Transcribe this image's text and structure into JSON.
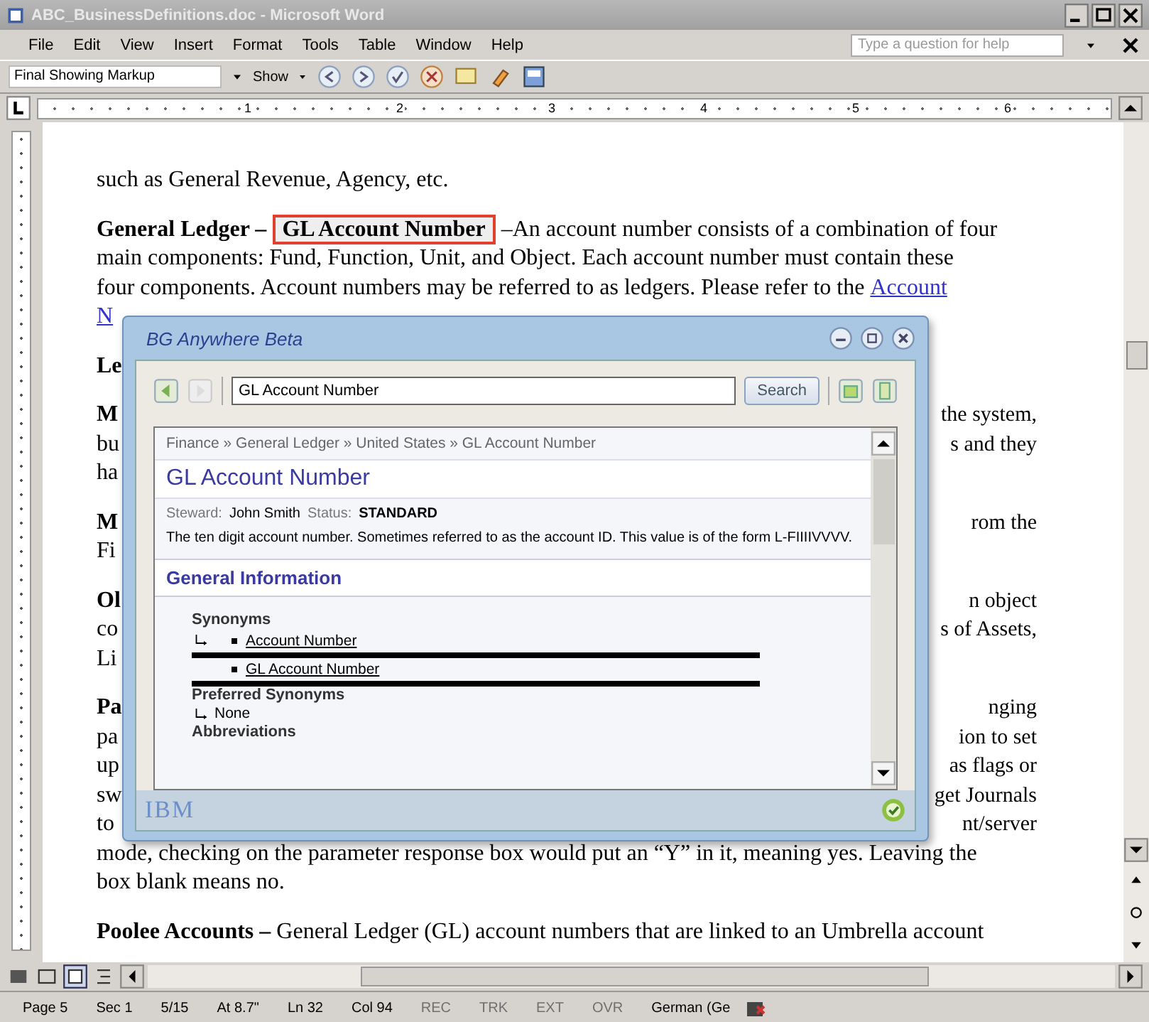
{
  "window": {
    "title": "ABC_BusinessDefinitions.doc - Microsoft Word"
  },
  "menu": [
    "File",
    "Edit",
    "View",
    "Insert",
    "Format",
    "Tools",
    "Table",
    "Window",
    "Help"
  ],
  "help_box": {
    "placeholder": "Type a question for help"
  },
  "toolbar": {
    "markup_dropdown": "Final Showing Markup",
    "show_button": "Show"
  },
  "ruler": {
    "marks": [
      "1",
      "2",
      "3",
      "4",
      "5",
      "6"
    ]
  },
  "document": {
    "paragraphs": [
      {
        "lines": [
          {
            "runs": [
              {
                "kind": "text",
                "text": "such as General Revenue, Agency, etc."
              }
            ]
          }
        ]
      },
      {
        "lines": [
          {
            "runs": [
              {
                "kind": "text",
                "text": "**General Ledger –**"
              },
              {
                "kind": "term",
                "text": "GL Account Number"
              },
              {
                "kind": "text",
                "text": "–An account number consists of a combination of four"
              }
            ]
          },
          {
            "runs": [
              {
                "kind": "text",
                "text": "main components: Fund, Function, Unit, and Object. Each account number must contain these"
              }
            ]
          },
          {
            "runs": [
              {
                "kind": "text",
                "text": "four components. Account numbers may be referred to as ledgers. Please refer to the"
              },
              {
                "kind": "link",
                "text": "Account"
              }
            ]
          },
          {
            "runs": [
              {
                "kind": "link",
                "text": "N"
              }
            ]
          }
        ]
      },
      {
        "lines": [
          {
            "runs": [
              {
                "kind": "text",
                "text": "**Le**"
              }
            ]
          }
        ]
      },
      {
        "lines": [
          {
            "runs": [
              {
                "kind": "text",
                "text": "**M**"
              }
            ],
            "right": "the system,"
          },
          {
            "runs": [
              {
                "kind": "text",
                "text": "bu"
              }
            ],
            "right": "s and they"
          },
          {
            "runs": [
              {
                "kind": "text",
                "text": "ha"
              }
            ]
          }
        ]
      },
      {
        "lines": [
          {
            "runs": [
              {
                "kind": "text",
                "text": "**M**"
              }
            ],
            "right": "rom the"
          },
          {
            "runs": [
              {
                "kind": "text",
                "text": "Fi"
              }
            ]
          }
        ]
      },
      {
        "lines": [
          {
            "runs": [
              {
                "kind": "text",
                "text": "**Ol**"
              }
            ],
            "right": "n object"
          },
          {
            "runs": [
              {
                "kind": "text",
                "text": "co"
              }
            ],
            "right": "s of Assets,"
          },
          {
            "runs": [
              {
                "kind": "text",
                "text": "Li"
              }
            ]
          }
        ]
      },
      {
        "lines": [
          {
            "runs": [
              {
                "kind": "text",
                "text": "**Pa**"
              }
            ],
            "right": "nging"
          },
          {
            "runs": [
              {
                "kind": "text",
                "text": "pa"
              }
            ],
            "right": "ion to set"
          },
          {
            "runs": [
              {
                "kind": "text",
                "text": "up"
              }
            ],
            "right": "as flags or"
          },
          {
            "runs": [
              {
                "kind": "text",
                "text": "sw"
              }
            ],
            "right": "get Journals"
          },
          {
            "runs": [
              {
                "kind": "text",
                "text": "to"
              }
            ],
            "right": "nt/server"
          },
          {
            "runs": [
              {
                "kind": "text",
                "text": "mode, checking on the parameter response box would put an “Y” in it, meaning yes. Leaving the"
              }
            ]
          },
          {
            "runs": [
              {
                "kind": "text",
                "text": "box blank means no."
              }
            ]
          }
        ]
      },
      {
        "lines": [
          {
            "runs": [
              {
                "kind": "text",
                "text": "**Poolee Accounts –** General Ledger (GL) account numbers that are linked to an Umbrella account"
              }
            ]
          }
        ]
      }
    ]
  },
  "popup": {
    "title": "BG Anywhere Beta",
    "search": {
      "value": "GL Account Number",
      "button": "Search"
    },
    "breadcrumb": "Finance » General Ledger » United States » GL Account Number",
    "heading": "GL Account Number",
    "steward_label": "Steward:",
    "steward": "John Smith",
    "status_label": "Status:",
    "status": "STANDARD",
    "description": "The ten digit account number. Sometimes referred to as the account ID. This value is of the form L-FIIIIVVVV.",
    "section": "General Information",
    "groups": [
      {
        "kind": "list",
        "label": "Synonyms",
        "items": [
          "Account Number",
          "GL Account Number"
        ]
      },
      {
        "kind": "value",
        "label": "Preferred Synonyms",
        "value": "None"
      },
      {
        "kind": "empty",
        "label": "Abbreviations"
      }
    ],
    "footer_logo": "IBM"
  },
  "status_bar": [
    {
      "text": "Page 5",
      "disabled": false
    },
    {
      "text": "Sec 1",
      "disabled": false
    },
    {
      "text": "5/15",
      "disabled": false
    },
    {
      "text": "At 8.7\"",
      "disabled": false
    },
    {
      "text": "Ln 32",
      "disabled": false
    },
    {
      "text": "Col 94",
      "disabled": false
    },
    {
      "text": "REC",
      "disabled": true
    },
    {
      "text": "TRK",
      "disabled": true
    },
    {
      "text": "EXT",
      "disabled": true
    },
    {
      "text": "OVR",
      "disabled": true
    },
    {
      "text": "German (Ge",
      "disabled": false
    }
  ]
}
